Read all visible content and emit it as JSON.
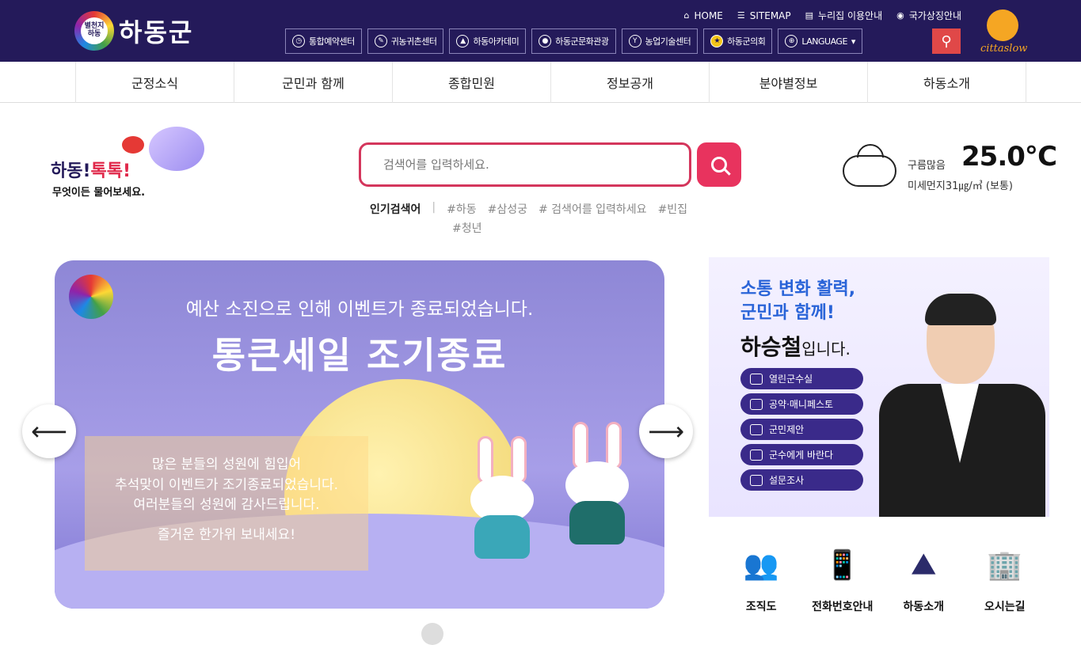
{
  "header": {
    "logo_text": "하동군",
    "logo_mark_text": "별천지 하동",
    "util_links": [
      {
        "icon": "home-icon",
        "label": "HOME"
      },
      {
        "icon": "sitemap-icon",
        "label": "SITEMAP"
      },
      {
        "icon": "document-icon",
        "label": "누리집 이용안내"
      },
      {
        "icon": "korea-flag-icon",
        "label": "국가상징안내"
      }
    ],
    "quick_links": [
      {
        "icon": "clock-icon",
        "label": "통합예약센터"
      },
      {
        "icon": "farm-icon",
        "label": "귀농귀촌센터"
      },
      {
        "icon": "academy-icon",
        "label": "하동아카데미"
      },
      {
        "icon": "location-icon",
        "label": "하동군문화관광"
      },
      {
        "icon": "sprout-icon",
        "label": "농업기술센터"
      },
      {
        "icon": "council-icon",
        "label": "하동군의회"
      },
      {
        "icon": "globe-icon",
        "label": "LANGUAGE"
      }
    ],
    "cittaslow_text": "cittaslow"
  },
  "nav": {
    "items": [
      "군정소식",
      "군민과 함께",
      "종합민원",
      "정보공개",
      "분야별정보",
      "하동소개"
    ]
  },
  "toktok": {
    "title_prefix": "하동!",
    "title_emph": "톡톡!",
    "subtitle": "무엇이든 물어보세요."
  },
  "search": {
    "placeholder": "검색어를 입력하세요.",
    "popular_label": "인기검색어",
    "popular_keywords": [
      "#하동",
      "#삼성궁",
      "# 검색어를 입력하세요",
      "#빈집",
      "#청년"
    ]
  },
  "weather": {
    "condition": "구름많음",
    "temperature": "25.0℃",
    "dust": "미세먼지31㎍/㎥ (보통)"
  },
  "banner": {
    "line1": "예산 소진으로 인해 이벤트가 종료되었습니다.",
    "line2": "통큰세일 조기종료",
    "box_lines": [
      "많은 분들의 성원에 힘입어",
      "추석맞이 이벤트가 조기종료되었습니다.",
      "여러분들의 성원에 감사드립니다."
    ],
    "box_closing": "즐거운 한가위 보내세요!",
    "logo_text": "별천지 하동"
  },
  "mayor": {
    "slogan1": "소통 변화 활력,",
    "slogan2": "군민과 함께!",
    "name": "하승철",
    "name_suffix": "입니다.",
    "menu": [
      {
        "icon": "chat-icon",
        "label": "열린군수실"
      },
      {
        "icon": "manifesto-icon",
        "label": "공약·매니페스토"
      },
      {
        "icon": "proposal-icon",
        "label": "군민제안"
      },
      {
        "icon": "person-icon",
        "label": "군수에게 바란다"
      },
      {
        "icon": "survey-icon",
        "label": "설문조사"
      }
    ]
  },
  "quick_icons": [
    {
      "icon": "organization-icon",
      "label": "조직도"
    },
    {
      "icon": "phone-icon",
      "label": "전화번호안내"
    },
    {
      "icon": "mountain-icon",
      "label": "하동소개"
    },
    {
      "icon": "building-map-icon",
      "label": "오시는길"
    }
  ]
}
